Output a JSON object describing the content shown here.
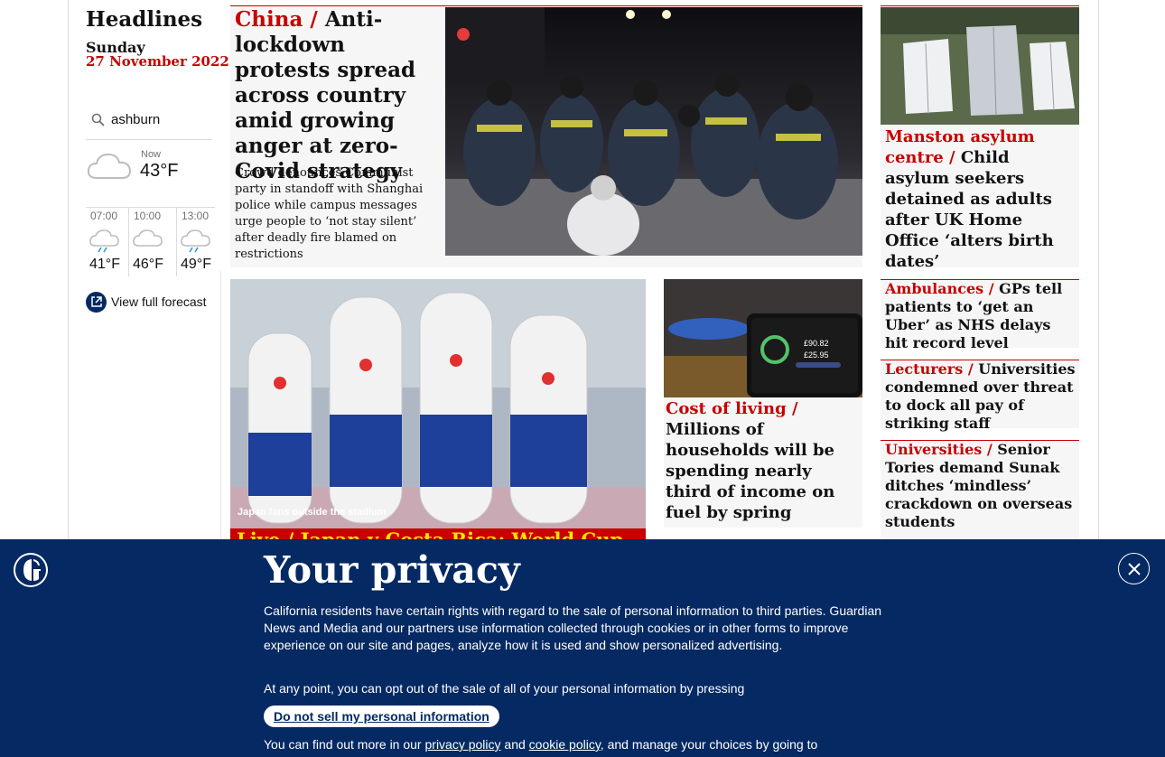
{
  "sidebar": {
    "section_title": "Headlines",
    "date_day": "Sunday",
    "date_full": "27 November 2022"
  },
  "weather": {
    "search_value": "ashburn",
    "now_label": "Now",
    "now_temp": "43°F",
    "now_icon": "cloud-icon",
    "forecast": [
      {
        "time": "07:00",
        "temp": "41°F",
        "icon": "cloud-rain-icon"
      },
      {
        "time": "10:00",
        "temp": "46°F",
        "icon": "cloud-icon"
      },
      {
        "time": "13:00",
        "temp": "49°F",
        "icon": "cloud-rain-icon"
      }
    ],
    "full_forecast_label": "View full forecast"
  },
  "stories": {
    "china": {
      "kicker": "China / ",
      "headline": "Anti-lockdown protests spread across country amid growing anger at zero-Covid strategy",
      "standfirst": "Crowd denounces Communist party in standoff with Shanghai police while campus messages urge people to ‘not stay silent’ after deadly fire blamed on restrictions"
    },
    "manston": {
      "kicker": "Manston asylum centre / ",
      "headline": "Child asylum seekers detained as adults after UK Home Office ‘alters birth dates’"
    },
    "worldcup": {
      "caption": "Japan fans outside the stadium",
      "live_text": "Live / Japan v Costa Rica: World Cup"
    },
    "cost_of_living": {
      "kicker": "Cost of living  / ",
      "headline": "Millions of households will be spending nearly third of income on fuel by spring",
      "meter_value_1": "£90.82",
      "meter_value_2": "£25.95"
    },
    "ambulances": {
      "kicker": "Ambulances / ",
      "headline": "GPs tell patients to ‘get an Uber’ as NHS delays hit record level"
    },
    "lecturers": {
      "kicker": "Lecturers / ",
      "headline": "Universities condemned over threat to dock all pay of striking staff"
    },
    "universities": {
      "kicker": "Universities / ",
      "headline": "Senior Tories demand Sunak ditches ‘mindless’ crackdown on overseas students"
    }
  },
  "privacy": {
    "title": "Your privacy",
    "body": "California residents have certain rights with regard to the sale of personal information to third parties. Guardian News and Media and our partners use information collected through cookies or in other forms to improve experience on our site and pages, analyze how it is used and show personalized advertising.",
    "body2": "At any point, you can opt out of the sale of all of your personal information by pressing",
    "button_label": "Do not sell my personal information",
    "body3_prefix": "You can find out more in our ",
    "privacy_policy_link": "privacy policy",
    "and_text": " and ",
    "cookie_policy_link": "cookie policy",
    "body3_suffix": ", and manage your choices by going to"
  },
  "colors": {
    "brand_blue": "#052962",
    "news_red": "#c70000",
    "live_yellow": "#ffe500"
  }
}
